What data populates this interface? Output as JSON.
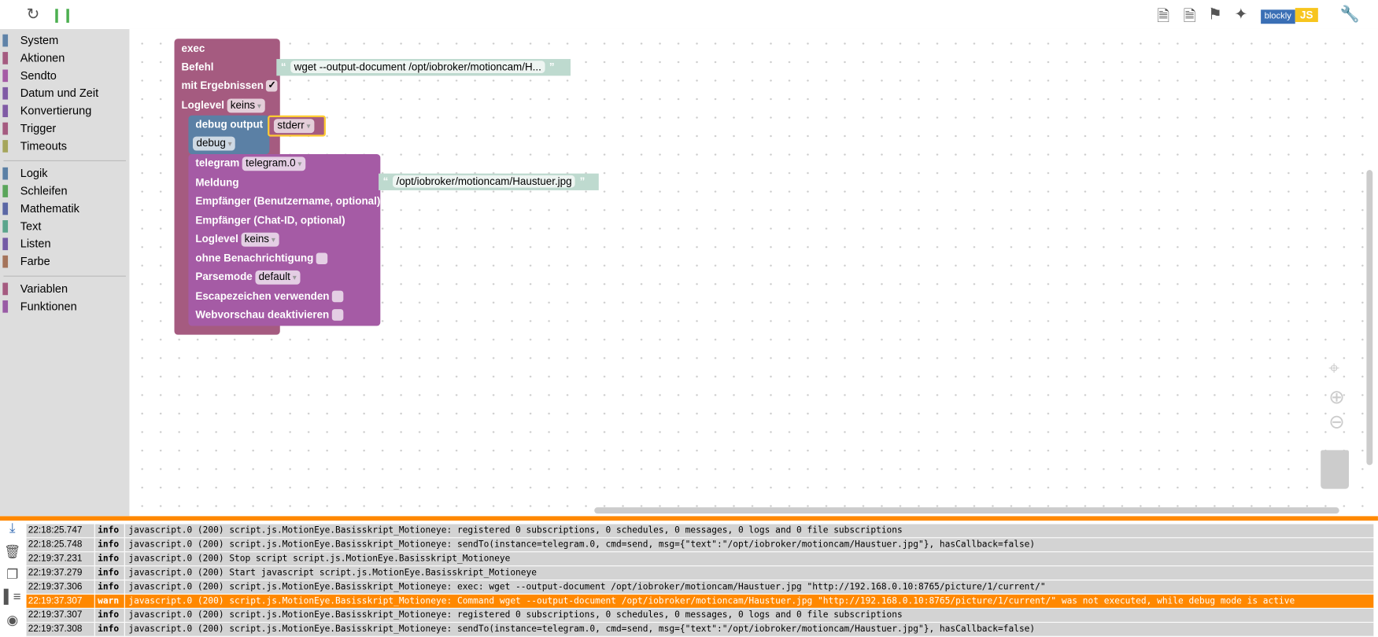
{
  "toolbar": {
    "refresh_icon": "refresh-icon",
    "pause_icon": "pause-icon",
    "right_icons": [
      "export-icon",
      "import-icon",
      "flag-icon",
      "sparkle-icon",
      "blockly-js-icon",
      "wrench-icon"
    ],
    "blockly_label": "blockly",
    "js_label": "JS"
  },
  "sidebar": {
    "groups": [
      [
        {
          "label": "System",
          "color": "#6083a8"
        },
        {
          "label": "Aktionen",
          "color": "#a55b80"
        },
        {
          "label": "Sendto",
          "color": "#a55ba5"
        },
        {
          "label": "Datum und Zeit",
          "color": "#805ba5"
        },
        {
          "label": "Konvertierung",
          "color": "#805ba5"
        },
        {
          "label": "Trigger",
          "color": "#a55b80"
        },
        {
          "label": "Timeouts",
          "color": "#a5a55b"
        }
      ],
      [
        {
          "label": "Logik",
          "color": "#5b80a5"
        },
        {
          "label": "Schleifen",
          "color": "#5ba55b"
        },
        {
          "label": "Mathematik",
          "color": "#5b67a5"
        },
        {
          "label": "Text",
          "color": "#5ba58c"
        },
        {
          "label": "Listen",
          "color": "#745ba5"
        },
        {
          "label": "Farbe",
          "color": "#a5745b"
        }
      ],
      [
        {
          "label": "Variablen",
          "color": "#a55b80"
        },
        {
          "label": "Funktionen",
          "color": "#995ba5"
        }
      ]
    ]
  },
  "blocks": {
    "exec": {
      "title": "exec",
      "befehl": "Befehl",
      "mit_ergebnissen": "mit Ergebnissen",
      "check": "✓",
      "loglevel": "Loglevel",
      "loglevel_value": "keins",
      "command": "wget --output-document /opt/iobroker/motioncam/H..."
    },
    "debug": {
      "title": "debug output",
      "value": "stderr",
      "level": "debug"
    },
    "telegram": {
      "title": "telegram",
      "instance": "telegram.0",
      "meldung": "Meldung",
      "message": "/opt/iobroker/motioncam/Haustuer.jpg",
      "empf_user": "Empfänger (Benutzername, optional)",
      "empf_chat": "Empfänger (Chat-ID, optional)",
      "loglevel": "Loglevel",
      "loglevel_value": "keins",
      "ohne": "ohne Benachrichtigung",
      "parsemode": "Parsemode",
      "parsemode_value": "default",
      "escape": "Escapezeichen verwenden",
      "webvorschau": "Webvorschau deaktivieren"
    }
  },
  "colors": {
    "exec": "#a55b80",
    "debug": "#5b80a5",
    "telegram": "#a55ba5",
    "string": "#bedacf",
    "warn": "#ff8800"
  },
  "log": {
    "rows": [
      {
        "time": "22:18:25.747",
        "level": "info",
        "msg": "javascript.0 (200) script.js.MotionEye.Basisskript_Motioneye: registered 0 subscriptions, 0 schedules, 0 messages, 0 logs and 0 file subscriptions"
      },
      {
        "time": "22:18:25.748",
        "level": "info",
        "msg": "javascript.0 (200) script.js.MotionEye.Basisskript_Motioneye: sendTo(instance=telegram.0, cmd=send, msg={\"text\":\"/opt/iobroker/motioncam/Haustuer.jpg\"}, hasCallback=false)"
      },
      {
        "time": "22:19:37.231",
        "level": "info",
        "msg": "javascript.0 (200) Stop script script.js.MotionEye.Basisskript_Motioneye"
      },
      {
        "time": "22:19:37.279",
        "level": "info",
        "msg": "javascript.0 (200) Start javascript script.js.MotionEye.Basisskript_Motioneye"
      },
      {
        "time": "22:19:37.306",
        "level": "info",
        "msg": "javascript.0 (200) script.js.MotionEye.Basisskript_Motioneye: exec: wget --output-document /opt/iobroker/motioncam/Haustuer.jpg \"http://192.168.0.10:8765/picture/1/current/\""
      },
      {
        "time": "22:19:37.307",
        "level": "warn",
        "msg": "javascript.0 (200) script.js.MotionEye.Basisskript_Motioneye: Command wget --output-document /opt/iobroker/motioncam/Haustuer.jpg \"http://192.168.0.10:8765/picture/1/current/\" was not executed, while debug mode is active"
      },
      {
        "time": "22:19:37.307",
        "level": "info",
        "msg": "javascript.0 (200) script.js.MotionEye.Basisskript_Motioneye: registered 0 subscriptions, 0 schedules, 0 messages, 0 logs and 0 file subscriptions"
      },
      {
        "time": "22:19:37.308",
        "level": "info",
        "msg": "javascript.0 (200) script.js.MotionEye.Basisskript_Motioneye: sendTo(instance=telegram.0, cmd=send, msg={\"text\":\"/opt/iobroker/motioncam/Haustuer.jpg\"}, hasCallback=false)"
      }
    ]
  }
}
